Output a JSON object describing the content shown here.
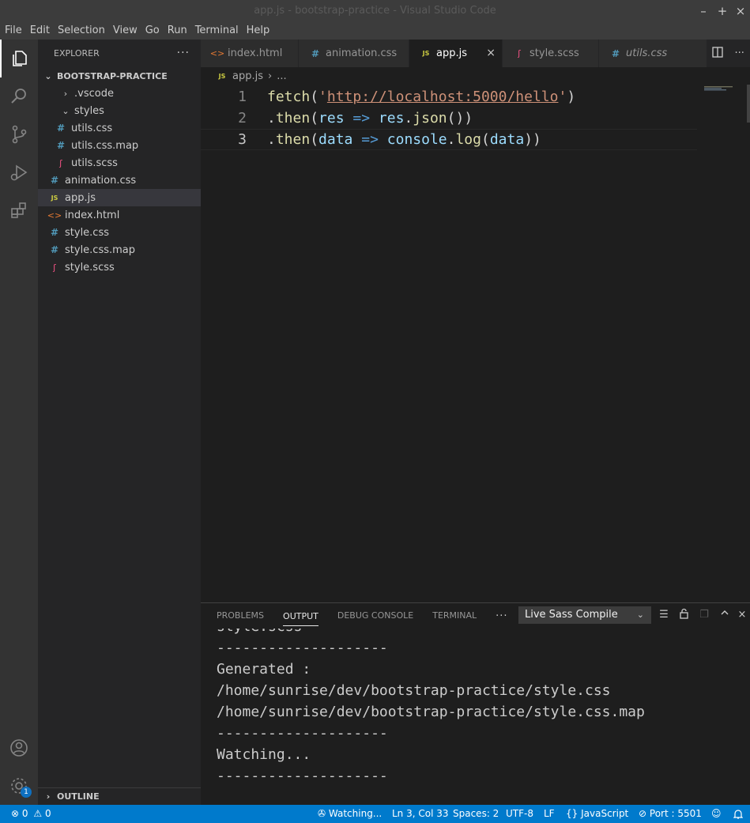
{
  "window": {
    "title": "app.js - bootstrap-practice - Visual Studio Code"
  },
  "menu": [
    "File",
    "Edit",
    "Selection",
    "View",
    "Go",
    "Run",
    "Terminal",
    "Help"
  ],
  "sidebar": {
    "header": "EXPLORER",
    "more": "···",
    "project": "BOOTSTRAP-PRACTICE",
    "items": [
      {
        "label": ".vscode",
        "type": "folder-collapsed",
        "icon": "chevron-right-icon"
      },
      {
        "label": "styles",
        "type": "folder-open",
        "icon": "chevron-down-icon"
      },
      {
        "label": "utils.css",
        "type": "css",
        "glyph": "#"
      },
      {
        "label": "utils.css.map",
        "type": "css",
        "glyph": "#"
      },
      {
        "label": "utils.scss",
        "type": "scss",
        "glyph": "ʃ"
      },
      {
        "label": "animation.css",
        "type": "css",
        "glyph": "#"
      },
      {
        "label": "app.js",
        "type": "js",
        "glyph": "JS"
      },
      {
        "label": "index.html",
        "type": "html",
        "glyph": "<>"
      },
      {
        "label": "style.css",
        "type": "css",
        "glyph": "#"
      },
      {
        "label": "style.css.map",
        "type": "css",
        "glyph": "#"
      },
      {
        "label": "style.scss",
        "type": "scss",
        "glyph": "ʃ"
      }
    ],
    "outline": "OUTLINE"
  },
  "tabs": [
    {
      "label": "index.html",
      "glyph": "<>",
      "type": "html"
    },
    {
      "label": "animation.css",
      "glyph": "#",
      "type": "css"
    },
    {
      "label": "app.js",
      "glyph": "JS",
      "type": "js",
      "close": "×"
    },
    {
      "label": "style.scss",
      "glyph": "ʃ",
      "type": "scss"
    },
    {
      "label": "utils.css",
      "glyph": "#",
      "type": "css"
    }
  ],
  "breadcrumb": {
    "glyph": "JS",
    "file": "app.js",
    "sep": "›",
    "rest": "..."
  },
  "editor": {
    "line_numbers": [
      "1",
      "2",
      "3"
    ],
    "line1": {
      "fn": "fetch",
      "open": "(",
      "q1": "'",
      "url": "http://localhost:5000/hello",
      "q2": "'",
      "close": ")"
    },
    "line2": {
      "dot": ".",
      "fn": "then",
      "open": "(",
      "param": "res",
      "arrow": " => ",
      "obj": "res",
      "dot2": ".",
      "method": "json",
      "close": "())"
    },
    "line3": {
      "dot": ".",
      "fn": "then",
      "open": "(",
      "param": "data",
      "arrow": " => ",
      "obj": "console",
      "dot2": ".",
      "method": "log",
      "open2": "(",
      "arg": "data",
      "close": "))"
    }
  },
  "panel": {
    "tabs": [
      "PROBLEMS",
      "OUTPUT",
      "DEBUG CONSOLE",
      "TERMINAL"
    ],
    "more": "···",
    "channel": "Live Sass Compile",
    "output_lines": [
      "style.scss",
      "--------------------",
      "Generated :",
      "/home/sunrise/dev/bootstrap-practice/style.css",
      "/home/sunrise/dev/bootstrap-practice/style.css.map",
      "--------------------",
      "Watching...",
      "--------------------"
    ]
  },
  "status": {
    "errors": "0",
    "warnings": "0",
    "watching": "Watching...",
    "position": "Ln 3, Col 33",
    "spaces": "Spaces: 2",
    "encoding": "UTF-8",
    "eol": "LF",
    "language": "JavaScript",
    "port": "Port : 5501"
  },
  "activity": {
    "settings_badge": "1"
  },
  "colors": {
    "accent": "#007acc",
    "editor_bg": "#1e1e1e",
    "sidebar_bg": "#252526"
  }
}
